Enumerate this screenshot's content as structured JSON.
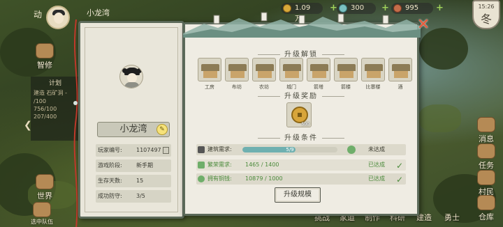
{
  "hud": {
    "top_left_label": "动",
    "player_village": "小龙湾",
    "resource_1": "1.09万",
    "resource_2": "300",
    "resource_3": "995",
    "time": "15:26",
    "season": "冬"
  },
  "left_sidebar": {
    "labels": [
      "智修",
      "世界",
      "选中队伍"
    ]
  },
  "plan_panel": {
    "title": "计划",
    "rows": [
      "建造 石矿洞 -",
      "/100",
      "756/100",
      "207/400"
    ]
  },
  "right_sidebar": {
    "labels": [
      "消息",
      "任务",
      "村民",
      "仓库"
    ]
  },
  "bottom_bar": {
    "labels": [
      "挑战",
      "家道",
      "制作",
      "科研",
      "建造",
      "勇士"
    ]
  },
  "profile": {
    "village_name": "小龙湾",
    "rows": [
      {
        "label": "玩家编号:",
        "value": "1107497"
      },
      {
        "label": "游戏阶段:",
        "value": "新手期"
      },
      {
        "label": "生存天数:",
        "value": "15"
      },
      {
        "label": "成功防守:",
        "value": "3/5"
      }
    ]
  },
  "upgrade": {
    "unlock_title": "升级解锁",
    "buildings": [
      "工房",
      "布坊",
      "农坊",
      "城门",
      "箭塔",
      "箭楼",
      "比寨楼",
      "酒"
    ],
    "reward_title": "升级奖励",
    "reward_count": "500",
    "condition_title": "升级条件",
    "conditions": {
      "build": {
        "label": "建筑需求:",
        "progress_text": "5/9",
        "progress_fraction": 0.556,
        "status": "未达成"
      },
      "prosperity": {
        "label": "繁荣需求:",
        "value": "1465 / 1400",
        "status": "已达成"
      },
      "copper": {
        "label": "拥有铜钱:",
        "value": "10879 / 1000",
        "status": "已达成"
      }
    },
    "button_label": "升级规模"
  },
  "colors": {
    "accent_green": "#4a8a3a",
    "progress": "#6fb0b0",
    "close": "#e85a3a"
  }
}
